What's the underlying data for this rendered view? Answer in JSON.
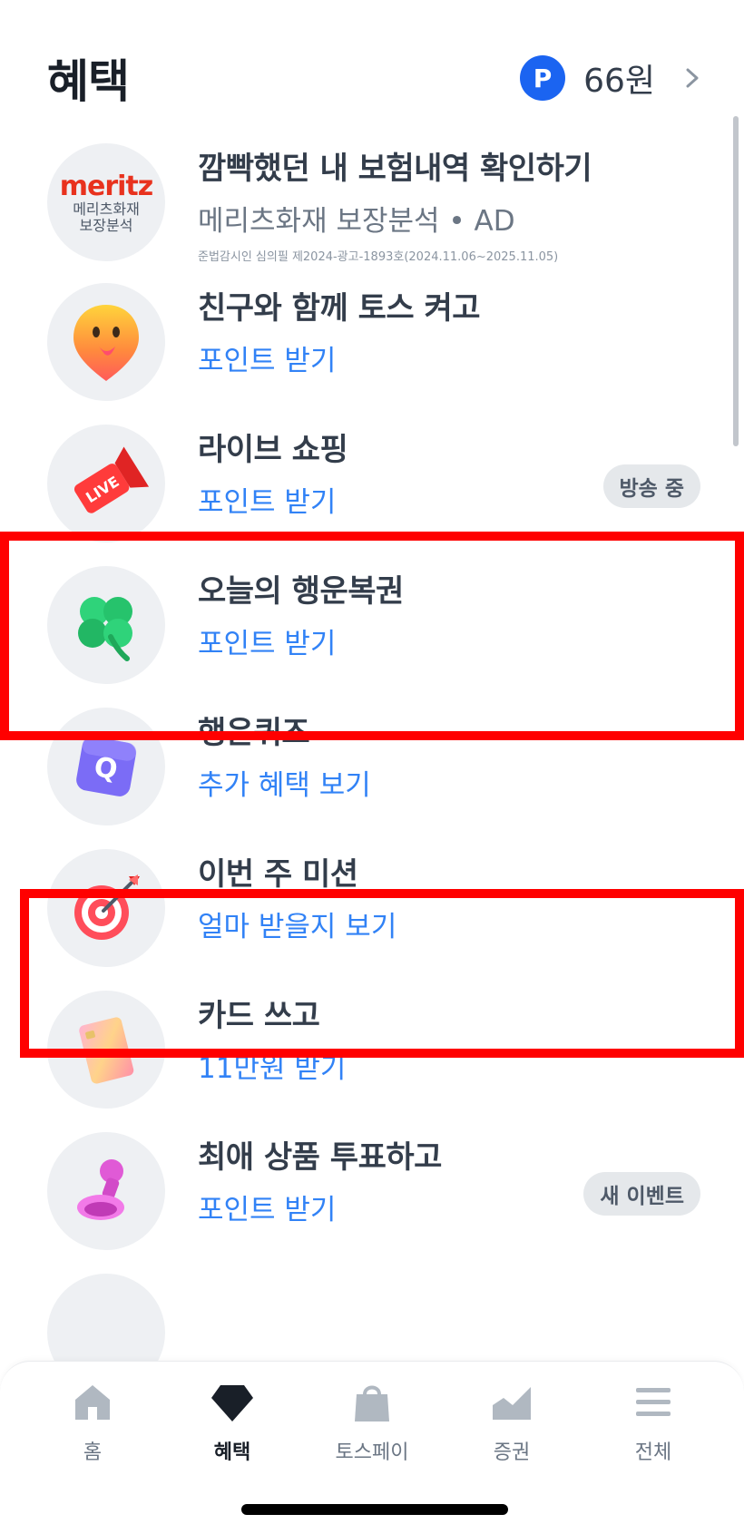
{
  "header": {
    "title": "혜택",
    "points_badge": "P",
    "points_amount": "66원"
  },
  "items": [
    {
      "title": "깜빡했던 내 보험내역 확인하기",
      "subtitle": "메리츠화재 보장분석 • AD",
      "fine_print": "준법감시인 심의필 제2024-광고-1893호(2024.11.06~2025.11.05)",
      "logo_word": "meritz",
      "logo_sub1": "메리츠화재",
      "logo_sub2": "보장분석",
      "icon": "meritz-logo"
    },
    {
      "title": "친구와 함께 토스 켜고",
      "subtitle": "포인트 받기",
      "icon": "smiley-pin-icon"
    },
    {
      "title": "라이브 쇼핑",
      "subtitle": "포인트 받기",
      "badge": "방송 중",
      "icon": "live-megaphone-icon",
      "icon_text": "LIVE"
    },
    {
      "title": "오늘의 행운복권",
      "subtitle": "포인트 받기",
      "icon": "clover-icon"
    },
    {
      "title": "행운퀴즈",
      "subtitle": "추가 혜택 보기",
      "icon": "quiz-cube-icon",
      "icon_text": "Q"
    },
    {
      "title": "이번 주 미션",
      "subtitle": "얼마 받을지 보기",
      "icon": "target-dart-icon"
    },
    {
      "title": "카드 쓰고",
      "subtitle": "11만원 받기",
      "icon": "card-icon"
    },
    {
      "title": "최애 상품 투표하고",
      "subtitle": "포인트 받기",
      "badge": "새 이벤트",
      "icon": "stamp-icon"
    }
  ],
  "tabbar": {
    "tabs": [
      {
        "label": "홈",
        "icon": "home-icon"
      },
      {
        "label": "혜택",
        "icon": "benefit-diamond-icon",
        "active": true
      },
      {
        "label": "토스페이",
        "icon": "shopping-bag-icon"
      },
      {
        "label": "증권",
        "icon": "chart-icon"
      },
      {
        "label": "전체",
        "icon": "menu-icon"
      }
    ]
  },
  "colors": {
    "accent": "#3182f6",
    "points_badge": "#1b64f1",
    "highlight": "#ff0000",
    "title_text": "#333d4b"
  }
}
